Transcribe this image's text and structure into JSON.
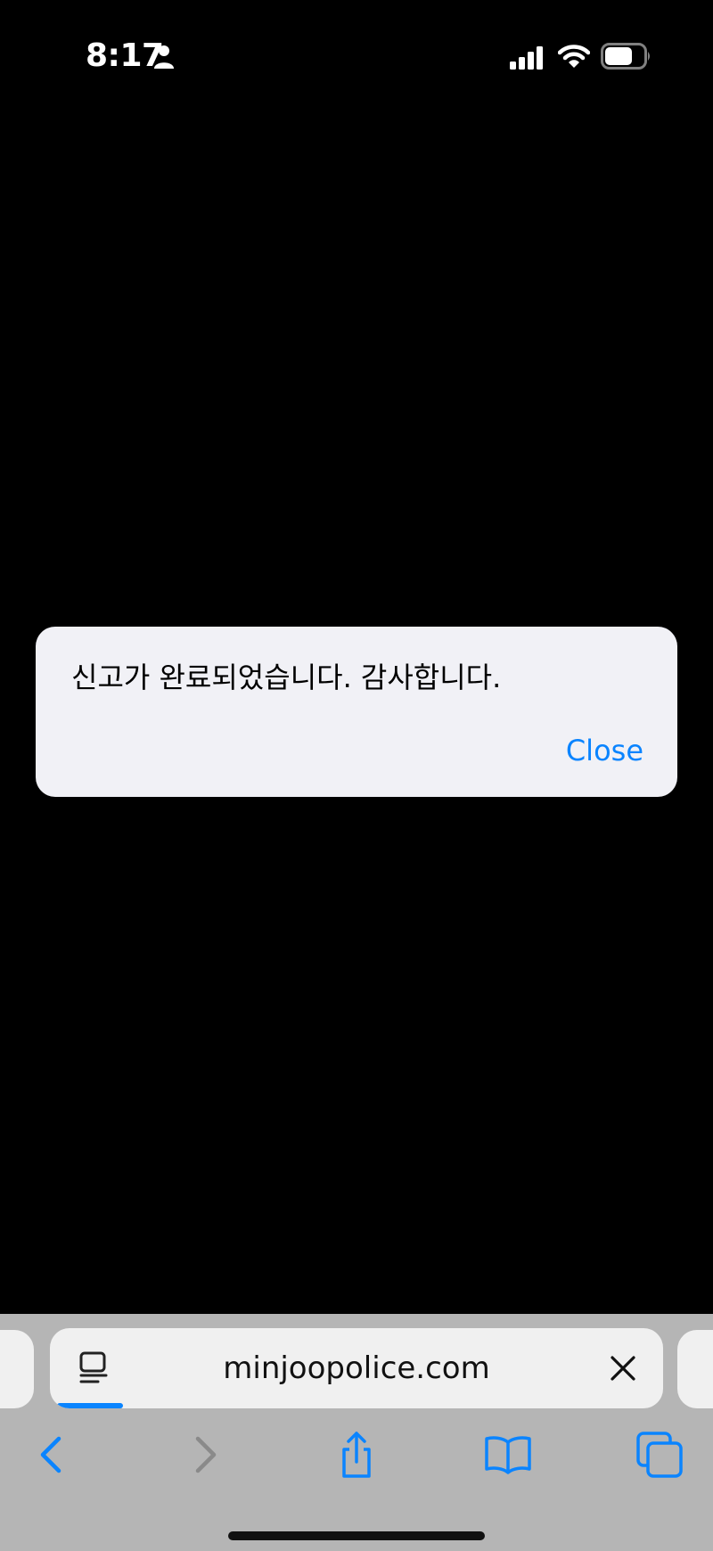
{
  "status_bar": {
    "time": "8:17",
    "icons": [
      "person-icon",
      "cellular-signal-icon",
      "wifi-icon",
      "battery-icon"
    ]
  },
  "alert": {
    "message": "신고가 완료되었습니다. 감사합니다.",
    "close_label": "Close"
  },
  "toolbar": {
    "url": "minjoopolice.com",
    "icons": [
      "reader-icon",
      "clear-icon",
      "back-icon",
      "forward-icon",
      "share-icon",
      "bookmarks-icon",
      "tabs-icon"
    ]
  },
  "colors": {
    "accent": "#0a84ff",
    "page_background": "#000000",
    "toolbar_background": "#b5b5b5",
    "alert_background": "#f1f1f6"
  }
}
